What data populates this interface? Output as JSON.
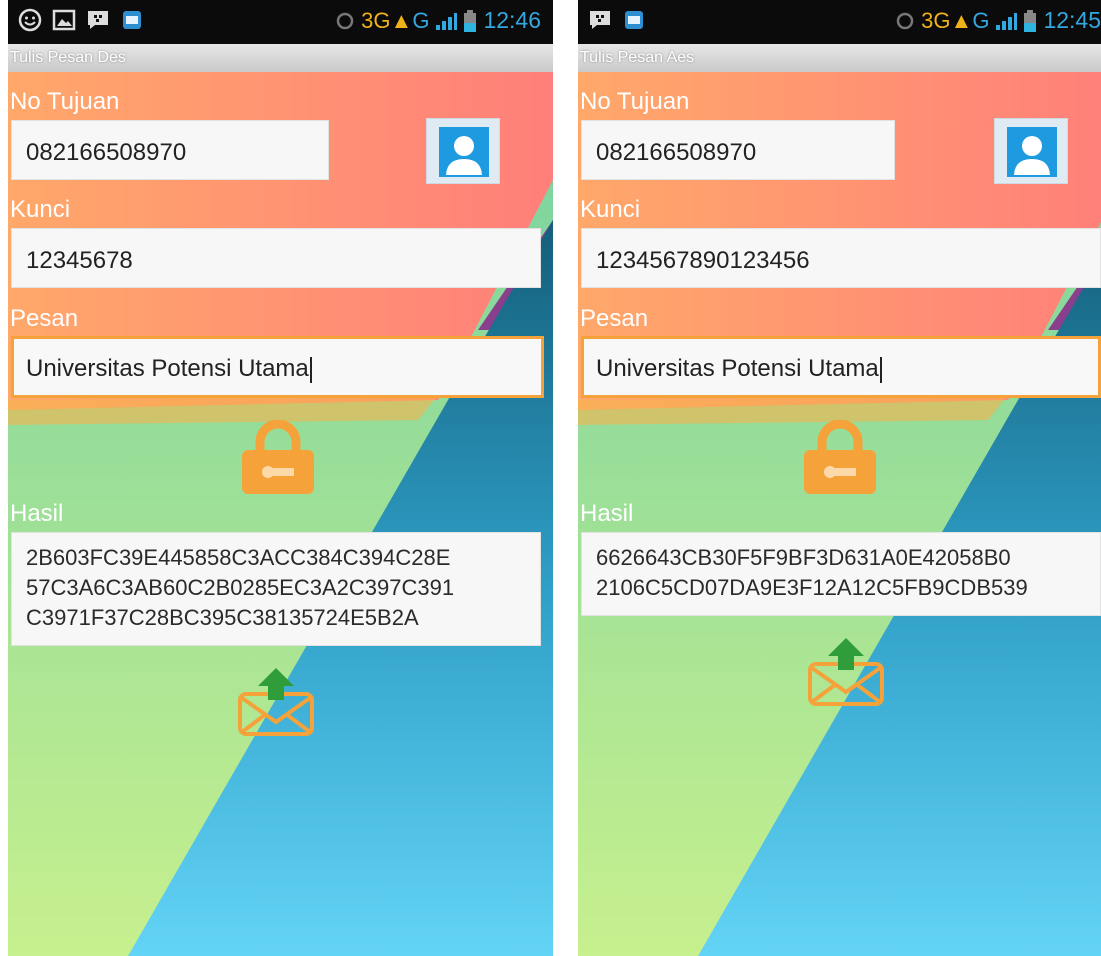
{
  "screens": [
    {
      "title": "Tulis Pesan Des",
      "status": {
        "network": "3G",
        "network_g": "G",
        "time": "12:46"
      },
      "no_tujuan_label": "No Tujuan",
      "no_tujuan_value": "082166508970",
      "kunci_label": "Kunci",
      "kunci_value": "12345678",
      "pesan_label": "Pesan",
      "pesan_value": "Universitas Potensi Utama",
      "hasil_label": "Hasil",
      "hasil_lines": [
        "2B603FC39E445858C3ACC384C394C28E",
        "57C3A6C3AB60C2B0285EC3A2C397C391",
        "C3971F37C28BC395C38135724E5B2A"
      ]
    },
    {
      "title": "Tulis Pesan Aes",
      "status": {
        "network": "3G",
        "network_g": "G",
        "time": "12:45"
      },
      "no_tujuan_label": "No Tujuan",
      "no_tujuan_value": "082166508970",
      "kunci_label": "Kunci",
      "kunci_value": "1234567890123456",
      "pesan_label": "Pesan",
      "pesan_value": "Universitas Potensi Utama",
      "hasil_label": "Hasil",
      "hasil_lines": [
        "6626643CB30F5F9BF3D631A0E42058B0",
        "2106C5CD07DA9E3F12A12C5FB9CDB539"
      ]
    }
  ],
  "icons": {
    "contact": "contact-person-icon",
    "encrypt": "padlock-icon",
    "send": "send-envelope-icon"
  },
  "colors": {
    "accent_orange": "#f5a23a",
    "contact_blue": "#1e9be0",
    "send_green": "#2f9e3a",
    "status_blue": "#33a8e0"
  }
}
